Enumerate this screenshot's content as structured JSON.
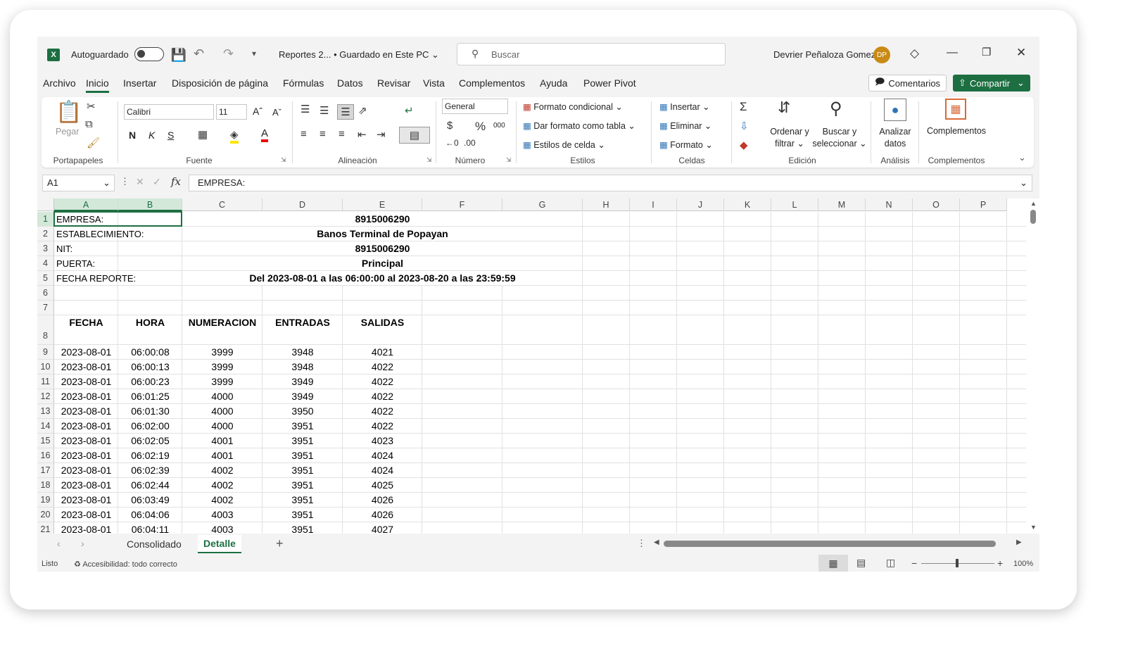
{
  "titlebar": {
    "autosave_label": "Autoguardado",
    "doc_title": "Reportes 2...",
    "save_status": "• Guardado en Este PC",
    "search_placeholder": "Buscar",
    "user_name": "Devrier Peñaloza Gomez",
    "user_initials": "DP"
  },
  "menu": {
    "items": [
      "Archivo",
      "Inicio",
      "Insertar",
      "Disposición de página",
      "Fórmulas",
      "Datos",
      "Revisar",
      "Vista",
      "Complementos",
      "Ayuda",
      "Power Pivot"
    ],
    "active": "Inicio",
    "comments_label": "Comentarios",
    "share_label": "Compartir"
  },
  "ribbon": {
    "clipboard": {
      "paste_label": "Pegar",
      "group_label": "Portapapeles"
    },
    "font": {
      "font_name": "Calibri",
      "font_size": "11",
      "bold": "N",
      "italic": "K",
      "underline": "S",
      "group_label": "Fuente"
    },
    "alignment": {
      "group_label": "Alineación"
    },
    "number": {
      "format": "General",
      "group_label": "Número"
    },
    "styles": {
      "conditional": "Formato condicional",
      "as_table": "Dar formato como tabla",
      "cell_styles": "Estilos de celda",
      "group_label": "Estilos"
    },
    "cells": {
      "insert": "Insertar",
      "delete": "Eliminar",
      "format": "Formato",
      "group_label": "Celdas"
    },
    "editing": {
      "sort_line1": "Ordenar y",
      "sort_line2": "filtrar",
      "find_line1": "Buscar y",
      "find_line2": "seleccionar",
      "group_label": "Edición"
    },
    "analysis": {
      "line1": "Analizar",
      "line2": "datos",
      "group_label": "Análisis"
    },
    "addins": {
      "label": "Complementos",
      "group_label": "Complementos"
    }
  },
  "formula_bar": {
    "name_box": "A1",
    "content": "EMPRESA:"
  },
  "columns": [
    "A",
    "B",
    "C",
    "D",
    "E",
    "F",
    "G",
    "H",
    "I",
    "J",
    "K",
    "L",
    "M",
    "N",
    "O",
    "P"
  ],
  "rows": [
    "1",
    "2",
    "3",
    "4",
    "5",
    "6",
    "7",
    "8",
    "9",
    "10",
    "11",
    "12",
    "13",
    "14",
    "15",
    "16",
    "17",
    "18",
    "19",
    "20",
    "21"
  ],
  "header_info": {
    "empresa_label": "EMPRESA:",
    "empresa_value": "8915006290",
    "establecimiento_label": "ESTABLECIMIENTO:",
    "establecimiento_value": "Banos Terminal de Popayan",
    "nit_label": "NIT:",
    "nit_value": "8915006290",
    "puerta_label": "PUERTA:",
    "puerta_value": "Principal",
    "fecha_label": "FECHA REPORTE:",
    "fecha_value": "Del 2023-08-01 a las 06:00:00 al 2023-08-20 a las 23:59:59"
  },
  "table_headers": [
    "FECHA",
    "HORA",
    "NUMERACION",
    "ENTRADAS",
    "SALIDAS"
  ],
  "table_rows": [
    [
      "2023-08-01",
      "06:00:08",
      "3999",
      "3948",
      "4021"
    ],
    [
      "2023-08-01",
      "06:00:13",
      "3999",
      "3948",
      "4022"
    ],
    [
      "2023-08-01",
      "06:00:23",
      "3999",
      "3949",
      "4022"
    ],
    [
      "2023-08-01",
      "06:01:25",
      "4000",
      "3949",
      "4022"
    ],
    [
      "2023-08-01",
      "06:01:30",
      "4000",
      "3950",
      "4022"
    ],
    [
      "2023-08-01",
      "06:02:00",
      "4000",
      "3951",
      "4022"
    ],
    [
      "2023-08-01",
      "06:02:05",
      "4001",
      "3951",
      "4023"
    ],
    [
      "2023-08-01",
      "06:02:19",
      "4001",
      "3951",
      "4024"
    ],
    [
      "2023-08-01",
      "06:02:39",
      "4002",
      "3951",
      "4024"
    ],
    [
      "2023-08-01",
      "06:02:44",
      "4002",
      "3951",
      "4025"
    ],
    [
      "2023-08-01",
      "06:03:49",
      "4002",
      "3951",
      "4026"
    ],
    [
      "2023-08-01",
      "06:04:06",
      "4003",
      "3951",
      "4026"
    ],
    [
      "2023-08-01",
      "06:04:11",
      "4003",
      "3951",
      "4027"
    ]
  ],
  "sheets": {
    "tab1": "Consolidado",
    "tab2": "Detalle",
    "active": "Detalle"
  },
  "statusbar": {
    "ready": "Listo",
    "accessibility": "Accesibilidad: todo correcto",
    "zoom": "100%"
  },
  "colors": {
    "accent": "#1d6f42",
    "selection_header": "#d3e8d9"
  }
}
